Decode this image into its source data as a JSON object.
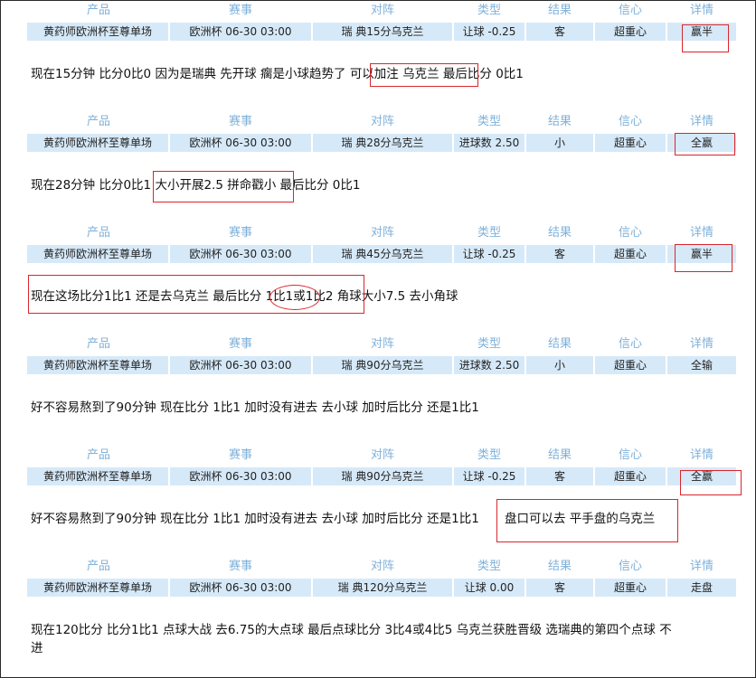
{
  "headers": [
    "产品",
    "赛事",
    "对阵",
    "类型",
    "结果",
    "信心",
    "详情"
  ],
  "picks": [
    {
      "product": "黄药师欧洲杯至尊单场",
      "event": "欧洲杯 06-30 03:00",
      "matchup": "瑞 典15分乌克兰",
      "type": "让球 -0.25",
      "result": "客",
      "confidence": "超重心",
      "detail": "赢半",
      "note": [
        "现在15分钟  比分0比0  因为是瑞典  先开球  瘸是小球趋势了 ",
        " 可以加注  乌克兰 ",
        " 最后比分    0比1"
      ]
    },
    {
      "product": "黄药师欧洲杯至尊单场",
      "event": "欧洲杯 06-30 03:00",
      "matchup": "瑞 典28分乌克兰",
      "type": "进球数 2.50",
      "result": "小",
      "confidence": "超重心",
      "detail": "全赢",
      "note": [
        "现在28分钟  比分0比1 ",
        " 大小开展2.5  拼命戳小 ",
        " 最后比分    0比1"
      ]
    },
    {
      "product": "黄药师欧洲杯至尊单场",
      "event": "欧洲杯 06-30 03:00",
      "matchup": "瑞 典45分乌克兰",
      "type": "让球 -0.25",
      "result": "客",
      "confidence": "超重心",
      "detail": "赢半",
      "note": [
        "现在这场比分1比1  还是去乌克兰  最后比分  ",
        "1比1",
        "或1比2  角球大小7.5  去小角球"
      ]
    },
    {
      "product": "黄药师欧洲杯至尊单场",
      "event": "欧洲杯 06-30 03:00",
      "matchup": "瑞 典90分乌克兰",
      "type": "进球数 2.50",
      "result": "小",
      "confidence": "超重心",
      "detail": "全输",
      "note": [
        "好不容易熬到了90分钟   现在比分   1比1   加时没有进去   去小球   加时后比分  还是1比1"
      ]
    },
    {
      "product": "黄药师欧洲杯至尊单场",
      "event": "欧洲杯 06-30 03:00",
      "matchup": "瑞 典90分乌克兰",
      "type": "让球 -0.25",
      "result": "客",
      "confidence": "超重心",
      "detail": "全赢",
      "note": [
        "好不容易熬到了90分钟  现在比分  1比1  加时没有进去  去小球  加时后比分  还是1比1",
        "盘口可以去   平手盘的乌克兰"
      ]
    },
    {
      "product": "黄药师欧洲杯至尊单场",
      "event": "欧洲杯 06-30 03:00",
      "matchup": "瑞 典120分乌克兰",
      "type": "让球 0.00",
      "result": "客",
      "confidence": "超重心",
      "detail": "走盘",
      "note": [
        "现在120比分   比分1比1   点球大战    去6.75的大点球    最后点球比分   3比4或4比5    乌克兰获胜晋级    选瑞典的第四个点球  不",
        "进"
      ]
    }
  ],
  "colors": {
    "header_text": "#7fb1da",
    "row_bg": "#d6e9f8",
    "annotation": "#d9262c",
    "border": "#2a2a2a"
  }
}
